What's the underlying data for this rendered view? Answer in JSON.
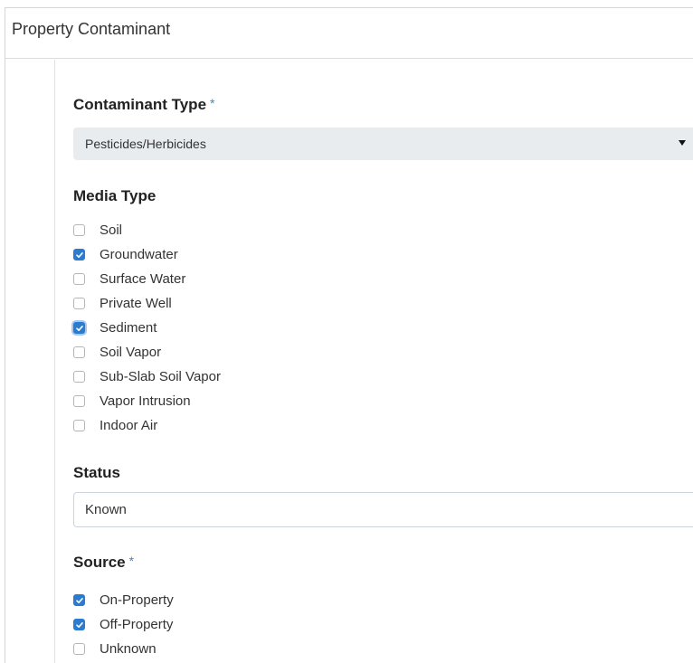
{
  "panel": {
    "title": "Property Contaminant"
  },
  "contaminant_type": {
    "label": "Contaminant Type",
    "required_mark": "*",
    "selected": "Pesticides/Herbicides"
  },
  "media_type": {
    "label": "Media Type",
    "options": [
      {
        "label": "Soil",
        "checked": false
      },
      {
        "label": "Groundwater",
        "checked": true
      },
      {
        "label": "Surface Water",
        "checked": false
      },
      {
        "label": "Private Well",
        "checked": false
      },
      {
        "label": "Sediment",
        "checked": true,
        "focused": true
      },
      {
        "label": "Soil Vapor",
        "checked": false
      },
      {
        "label": "Sub-Slab Soil Vapor",
        "checked": false
      },
      {
        "label": "Vapor Intrusion",
        "checked": false
      },
      {
        "label": "Indoor Air",
        "checked": false
      }
    ]
  },
  "status": {
    "label": "Status",
    "value": "Known"
  },
  "source": {
    "label": "Source",
    "required_mark": "*",
    "options": [
      {
        "label": "On-Property",
        "checked": true
      },
      {
        "label": "Off-Property",
        "checked": true
      },
      {
        "label": "Unknown",
        "checked": false
      }
    ]
  },
  "colors": {
    "accent": "#2b7bd0",
    "required": "#3a89c9",
    "select_bg": "#e9ecef"
  }
}
